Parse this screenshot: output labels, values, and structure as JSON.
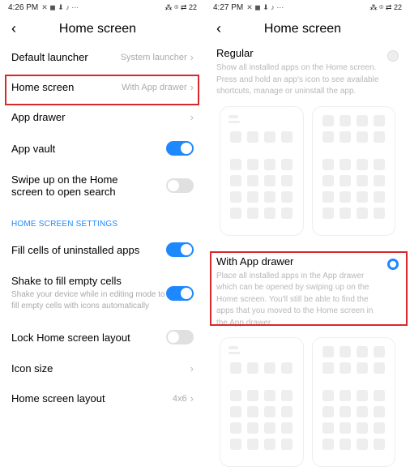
{
  "left": {
    "status": {
      "time": "4:26 PM",
      "icons_left": "✕ ◼ ⬇ ♪ ⋯",
      "icons_right": "⁂ ⌾ ⇄ 22"
    },
    "title": "Home screen",
    "rows": [
      {
        "label": "Default launcher",
        "value": "System launcher",
        "type": "nav"
      },
      {
        "label": "Home screen",
        "value": "With App drawer",
        "type": "nav"
      },
      {
        "label": "App drawer",
        "value": "",
        "type": "nav"
      },
      {
        "label": "App vault",
        "type": "toggle",
        "on": true
      },
      {
        "label": "Swipe up on the Home screen to open search",
        "type": "toggle",
        "on": false
      }
    ],
    "section": "HOME SCREEN SETTINGS",
    "rows2": [
      {
        "label": "Fill cells of uninstalled apps",
        "type": "toggle",
        "on": true
      },
      {
        "label": "Shake to fill empty cells",
        "desc": "Shake your device while in editing mode to fill empty cells with icons automatically",
        "type": "toggle",
        "on": true
      },
      {
        "label": "Lock Home screen layout",
        "type": "toggle",
        "on": false
      },
      {
        "label": "Icon size",
        "value": "",
        "type": "nav"
      },
      {
        "label": "Home screen layout",
        "value": "4x6",
        "type": "nav"
      }
    ]
  },
  "right": {
    "status": {
      "time": "4:27 PM",
      "icons_left": "✕ ◼ ⬇ ♪ ⋯",
      "icons_right": "⁂ ⌾ ⇄ 22"
    },
    "title": "Home screen",
    "option1": {
      "title": "Regular",
      "desc": "Show all installed apps on the Home screen. Press and hold an app's icon to see available shortcuts, manage or uninstall the app."
    },
    "option2": {
      "title": "With App drawer",
      "desc": "Place all installed apps in the App drawer which can be opened by swiping up on the Home screen. You'll still be able to find the apps that you moved to the Home screen in the App drawer."
    }
  }
}
